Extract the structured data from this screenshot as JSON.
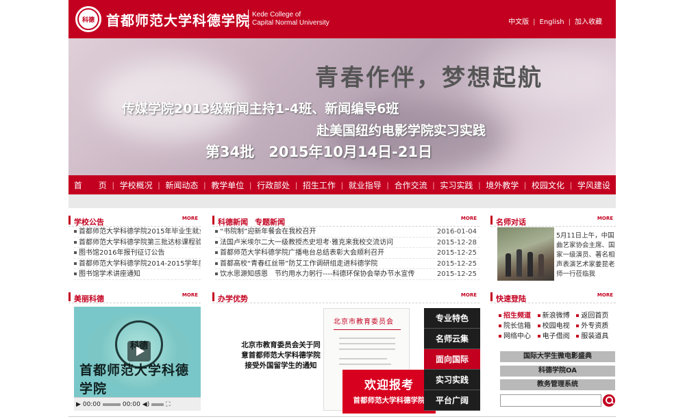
{
  "header": {
    "seal_text": "科德",
    "logo_cn": "首都师范大学科德学院",
    "logo_en_line1": "Kede College of",
    "logo_en_line2": "Capital Normal University",
    "links": [
      "中文版",
      "English",
      "加入收藏"
    ]
  },
  "banner": {
    "title": "青春作伴，梦想起航",
    "line1": "传媒学院2013级新闻主持1-4班、新闻编导6班",
    "line2": "赴美国纽约电影学院实习实践",
    "line3": "第34批　2015年10月14日-21日"
  },
  "nav": {
    "items": [
      "首　　页",
      "学校概况",
      "新闻动态",
      "教学单位",
      "行政部处",
      "招生工作",
      "就业指导",
      "合作交流",
      "实习实践",
      "境外教学",
      "校园文化",
      "学风建设"
    ]
  },
  "announcements": {
    "title": "学校公告",
    "more": "MORE",
    "items": [
      "首都师范大学科德学院2015年毕业生就业",
      "首都师范大学科德学院第三批达标课程验",
      "图书馆2016年报刊征订公告",
      "首都师范大学科德学院2014-2015学年度",
      "图书馆学术讲座通知"
    ]
  },
  "news": {
    "title": "科德新闻",
    "title2": "专题新闻",
    "more": "MORE",
    "items": [
      {
        "text": "“书院制”迎新年餐会在我校召开",
        "date": "2016-01-04"
      },
      {
        "text": "法国卢米埃尔二大一级教授杰史坦考·雅克来我校交流访问",
        "date": "2015-12-28"
      },
      {
        "text": "首都师范大学科德学院广播电台总结表彰大会顺利召开",
        "date": "2015-12-25"
      },
      {
        "text": "首都高校“青春红丝带”防艾工作调研组走进科德学院",
        "date": "2015-12-25"
      },
      {
        "text": "饮水思源知感恩　节约用水力躬行----科德环保协会举办节水宣传",
        "date": "2015-12-25"
      }
    ]
  },
  "dialogue": {
    "title": "名师对话",
    "more": "MORE",
    "text": "5月11日上午，中国曲艺家协会主席、国家一级演员、著名相声表演艺术家姜昆老师一行莅临我"
  },
  "beauty": {
    "title": "美丽科德",
    "more": "MORE",
    "video_seal": "科德",
    "video_title": "首都师范大学科德学院",
    "time_current": "00:00",
    "time_total": "00:00"
  },
  "advantage": {
    "title": "办学优势",
    "more": "MORE",
    "notice": "北京市教育委员会关于同意首都师范大学科德学院接受外国留学生的通知",
    "doc_header": "北京市教育委员会",
    "enroll_title": "欢迎报考",
    "enroll_sub": "首都师范大学科德学院",
    "tabs": [
      "专业特色",
      "名师云集",
      "面向国际",
      "实习实践",
      "平台广阔"
    ],
    "active_tab": 2
  },
  "quick": {
    "title": "快速登陆",
    "more": "MORE",
    "rows": [
      [
        "招生频道",
        "新浪微博",
        "返回首页"
      ],
      [
        "院长信箱",
        "校园电视",
        "外专资质"
      ],
      [
        "网络中心",
        "电子借阅",
        "服装道具"
      ]
    ],
    "buttons": [
      "国际大学生微电影盛典",
      "科德学院OA",
      "教务管理系统"
    ]
  },
  "colors": {
    "brand": "#c3001f",
    "active_tab": "#c3001f",
    "tab_bg": "#1e1e1e"
  }
}
